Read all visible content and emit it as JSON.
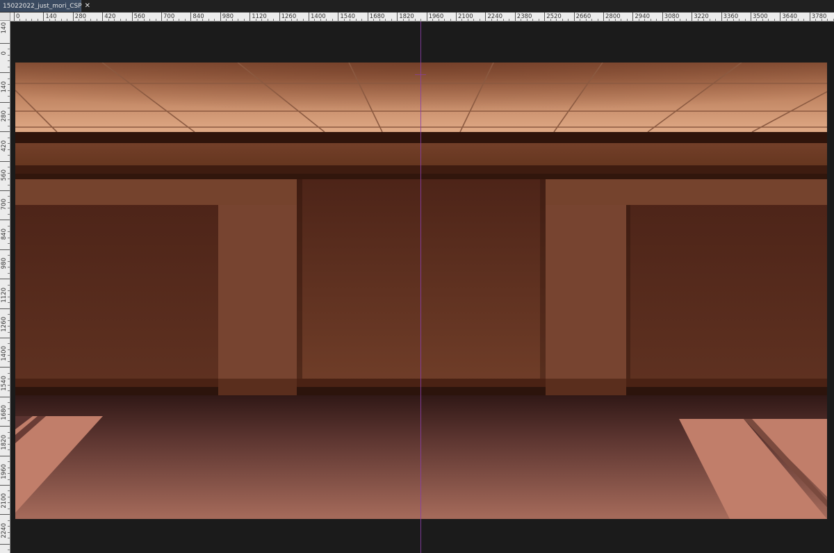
{
  "document_tab": {
    "title": "15022022_just_mori_CSP",
    "close_icon": "close-icon"
  },
  "ruler_horizontal": {
    "labels": [
      "0",
      "140",
      "280",
      "420",
      "560",
      "700",
      "840",
      "980",
      "1120",
      "1260",
      "1400",
      "1540",
      "1680",
      "1820",
      "1960",
      "2100",
      "2240",
      "2380",
      "2520",
      "2660",
      "2800",
      "2940",
      "3080",
      "3220",
      "3360",
      "3500",
      "3640",
      "3780"
    ]
  },
  "ruler_vertical": {
    "labels": [
      "140",
      "0",
      "140",
      "280",
      "420",
      "560",
      "700",
      "840",
      "980",
      "1120",
      "1260",
      "1400",
      "1540",
      "1680",
      "1820",
      "1960",
      "2100",
      "2240"
    ]
  },
  "canvas": {
    "content": "room-interior-illustration",
    "colors": {
      "workspace": "#1b1b1b",
      "ceiling_light": "#d9a07c",
      "ceiling_shadow": "#8a5338",
      "beam": "#2f140b",
      "wall": "#6b3a26",
      "pillar": "#774430",
      "floor_dark": "#3b1f1c",
      "floor_light": "#a46a5b",
      "light_patch": "#c17e6a",
      "guide": "#8a3ea8"
    }
  }
}
